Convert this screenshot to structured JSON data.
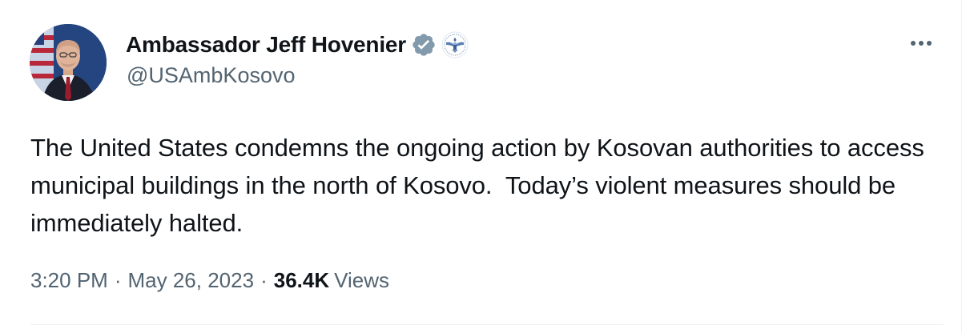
{
  "author": {
    "name": "Ambassador Jeff Hovenier",
    "handle": "@USAmbKosovo",
    "avatar_icon": "profile-photo",
    "verified_icon": "verified-badge-icon",
    "affiliation_icon": "us-state-department-seal-icon",
    "verified_color": "#829aab"
  },
  "actions": {
    "more_icon": "more-options-icon"
  },
  "tweet": {
    "text": "The United States condemns the ongoing action by Kosovan authorities to access municipal buildings in the north of Kosovo.  Today’s violent measures should be immediately halted."
  },
  "meta": {
    "time": "3:20 PM",
    "sep1": "·",
    "date": "May 26, 2023",
    "sep2": "·",
    "views_count": "36.4K",
    "views_label": "Views"
  },
  "colors": {
    "text": "#0f1419",
    "secondary": "#536471",
    "border": "#eff3f4"
  }
}
